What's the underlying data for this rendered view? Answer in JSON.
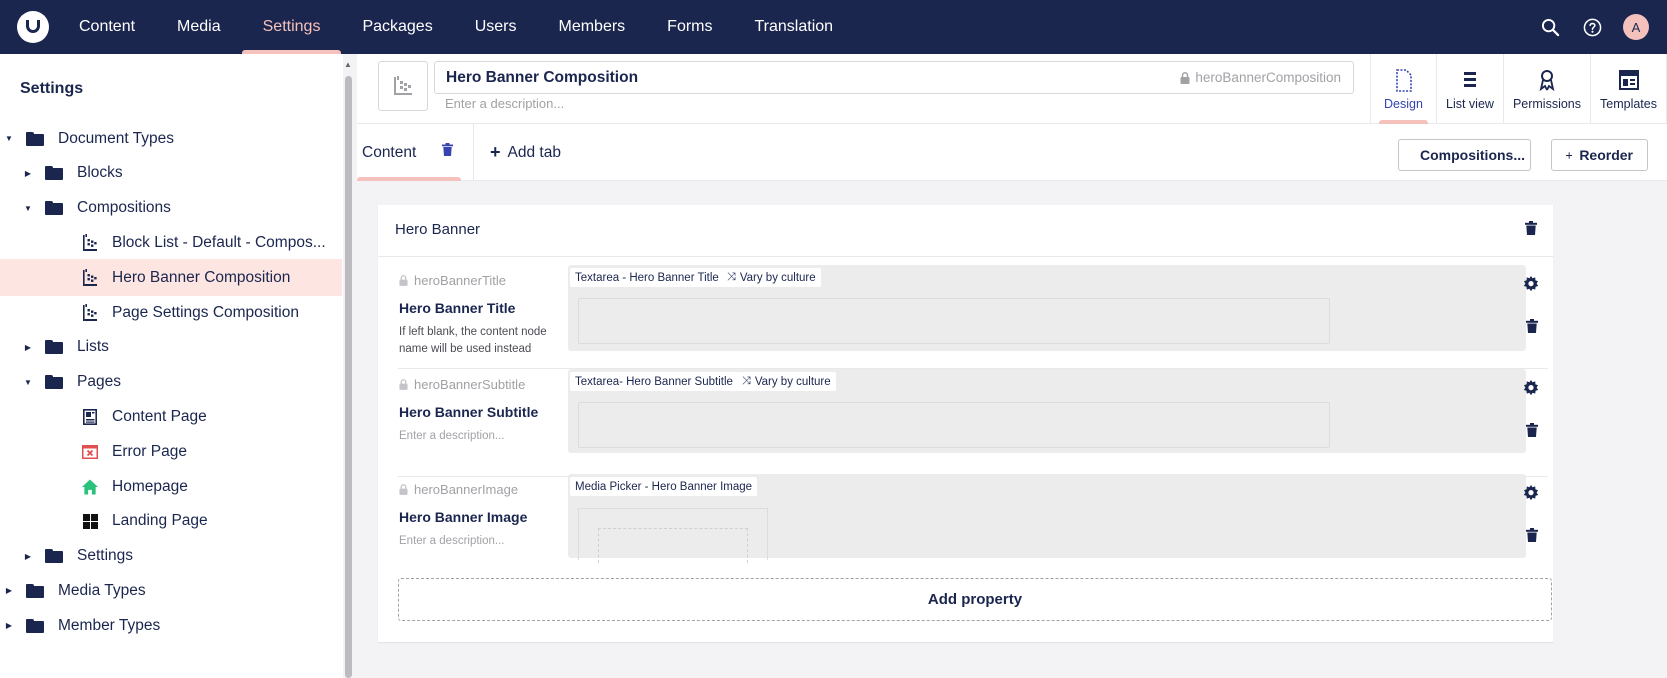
{
  "topbar": {
    "nav": [
      "Content",
      "Media",
      "Settings",
      "Packages",
      "Users",
      "Members",
      "Forms",
      "Translation"
    ],
    "active_nav": "Settings",
    "avatar_initial": "A",
    "icons": [
      "search-icon",
      "help-icon"
    ]
  },
  "sidebar": {
    "title": "Settings",
    "tree": [
      {
        "label": "Document Types",
        "icon": "folder",
        "state": "expanded"
      },
      {
        "label": "Blocks",
        "icon": "folder",
        "state": "collapsed"
      },
      {
        "label": "Compositions",
        "icon": "folder",
        "state": "expanded"
      },
      {
        "label": "Block List - Default - Compos...",
        "icon": "composition"
      },
      {
        "label": "Hero Banner Composition",
        "icon": "composition",
        "selected": true
      },
      {
        "label": "Page Settings Composition",
        "icon": "composition"
      },
      {
        "label": "Lists",
        "icon": "folder",
        "state": "collapsed"
      },
      {
        "label": "Pages",
        "icon": "folder",
        "state": "expanded"
      },
      {
        "label": "Content Page",
        "icon": "content-page"
      },
      {
        "label": "Error Page",
        "icon": "error-page"
      },
      {
        "label": "Homepage",
        "icon": "home"
      },
      {
        "label": "Landing Page",
        "icon": "grid"
      },
      {
        "label": "Settings",
        "icon": "folder",
        "state": "collapsed"
      },
      {
        "label": "Media Types",
        "icon": "folder",
        "state": "collapsed"
      },
      {
        "label": "Member Types",
        "icon": "folder",
        "state": "collapsed"
      }
    ]
  },
  "header": {
    "name": "Hero Banner Composition",
    "alias": "heroBannerComposition",
    "description_placeholder": "Enter a description...",
    "apps": [
      {
        "label": "Design",
        "active": true
      },
      {
        "label": "List view"
      },
      {
        "label": "Permissions"
      },
      {
        "label": "Templates"
      }
    ]
  },
  "tabs": {
    "tab_label": "Content",
    "add_tab": "Add tab",
    "compositions_button": "Compositions...",
    "reorder_button": "Reorder"
  },
  "group": {
    "title": "Hero Banner",
    "properties": [
      {
        "alias": "heroBannerTitle",
        "name": "Hero Banner Title",
        "description": "If left blank, the content node name will be used instead",
        "description_is_placeholder": false,
        "editor": "Textarea - Hero Banner Title",
        "vary": "Vary by culture"
      },
      {
        "alias": "heroBannerSubtitle",
        "name": "Hero Banner Subtitle",
        "description": "Enter a description...",
        "description_is_placeholder": true,
        "editor": "Textarea- Hero Banner Subtitle",
        "vary": "Vary by culture"
      },
      {
        "alias": "heroBannerImage",
        "name": "Hero Banner Image",
        "description": "Enter a description...",
        "description_is_placeholder": true,
        "editor": "Media Picker - Hero Banner Image",
        "vary": ""
      }
    ],
    "add_property": "Add property"
  },
  "colors": {
    "topbar": "#1b264f",
    "accent": "#f5c1bc",
    "selected_row": "#fde5e1",
    "active_app": "#3544b1"
  }
}
